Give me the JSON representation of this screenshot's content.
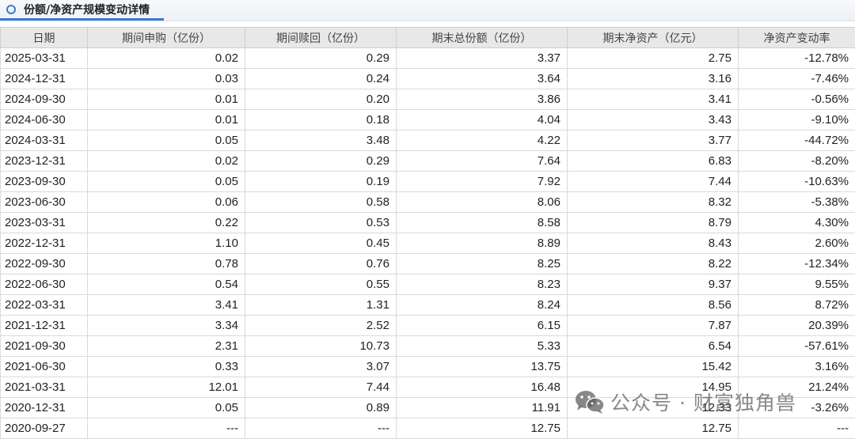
{
  "header": {
    "title": "份额/净资产规模变动详情",
    "icon": "circle-icon"
  },
  "table": {
    "columns": [
      "日期",
      "期间申购（亿份）",
      "期间赎回（亿份）",
      "期末总份额（亿份）",
      "期末净资产（亿元）",
      "净资产变动率"
    ],
    "rows": [
      [
        "2025-03-31",
        "0.02",
        "0.29",
        "3.37",
        "2.75",
        "-12.78%"
      ],
      [
        "2024-12-31",
        "0.03",
        "0.24",
        "3.64",
        "3.16",
        "-7.46%"
      ],
      [
        "2024-09-30",
        "0.01",
        "0.20",
        "3.86",
        "3.41",
        "-0.56%"
      ],
      [
        "2024-06-30",
        "0.01",
        "0.18",
        "4.04",
        "3.43",
        "-9.10%"
      ],
      [
        "2024-03-31",
        "0.05",
        "3.48",
        "4.22",
        "3.77",
        "-44.72%"
      ],
      [
        "2023-12-31",
        "0.02",
        "0.29",
        "7.64",
        "6.83",
        "-8.20%"
      ],
      [
        "2023-09-30",
        "0.05",
        "0.19",
        "7.92",
        "7.44",
        "-10.63%"
      ],
      [
        "2023-06-30",
        "0.06",
        "0.58",
        "8.06",
        "8.32",
        "-5.38%"
      ],
      [
        "2023-03-31",
        "0.22",
        "0.53",
        "8.58",
        "8.79",
        "4.30%"
      ],
      [
        "2022-12-31",
        "1.10",
        "0.45",
        "8.89",
        "8.43",
        "2.60%"
      ],
      [
        "2022-09-30",
        "0.78",
        "0.76",
        "8.25",
        "8.22",
        "-12.34%"
      ],
      [
        "2022-06-30",
        "0.54",
        "0.55",
        "8.23",
        "9.37",
        "9.55%"
      ],
      [
        "2022-03-31",
        "3.41",
        "1.31",
        "8.24",
        "8.56",
        "8.72%"
      ],
      [
        "2021-12-31",
        "3.34",
        "2.52",
        "6.15",
        "7.87",
        "20.39%"
      ],
      [
        "2021-09-30",
        "2.31",
        "10.73",
        "5.33",
        "6.54",
        "-57.61%"
      ],
      [
        "2021-06-30",
        "0.33",
        "3.07",
        "13.75",
        "15.42",
        "3.16%"
      ],
      [
        "2021-03-31",
        "12.01",
        "7.44",
        "16.48",
        "14.95",
        "21.24%"
      ],
      [
        "2020-12-31",
        "0.05",
        "0.89",
        "11.91",
        "12.33",
        "-3.26%"
      ],
      [
        "2020-09-27",
        "---",
        "---",
        "12.75",
        "12.75",
        "---"
      ]
    ]
  },
  "watermark": {
    "text": "公众号 · 财富独角兽",
    "icon": "wechat-icon"
  },
  "colors": {
    "accent": "#3a7bd5",
    "header_bg": "#e8e8e8"
  }
}
